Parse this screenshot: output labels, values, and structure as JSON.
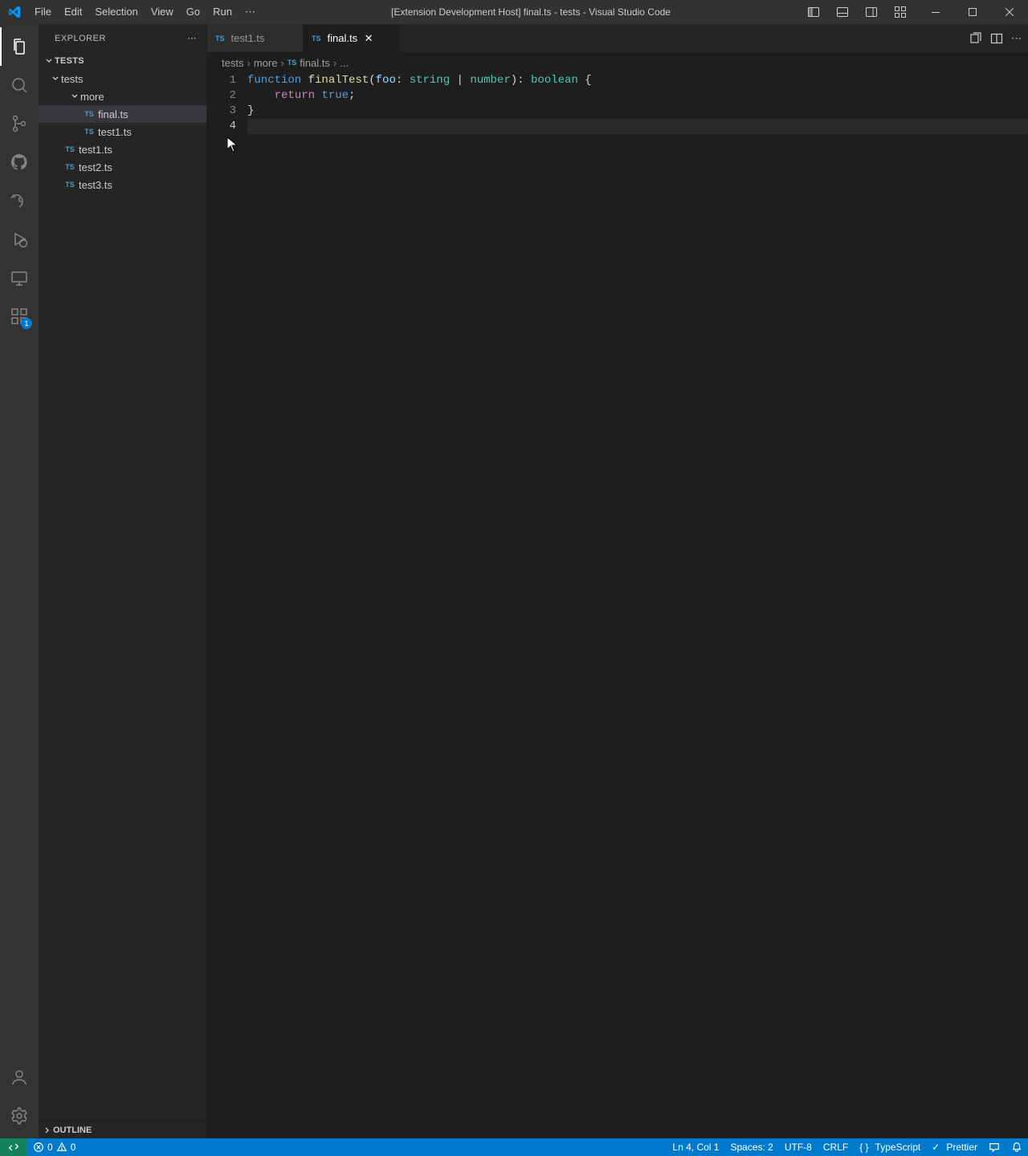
{
  "menu": {
    "items": [
      "File",
      "Edit",
      "Selection",
      "View",
      "Go",
      "Run"
    ],
    "more": "⋯"
  },
  "title": "[Extension Development Host] final.ts - tests - Visual Studio Code",
  "sidebar": {
    "title": "EXPLORER",
    "root": "TESTS",
    "tree": {
      "folder1": "tests",
      "folder2": "more",
      "files_more": [
        "final.ts",
        "test1.ts"
      ],
      "files_root": [
        "test1.ts",
        "test2.ts",
        "test3.ts"
      ]
    },
    "outline": "OUTLINE"
  },
  "tabs": {
    "t1": "test1.ts",
    "t2": "final.ts"
  },
  "breadcrumb": {
    "p1": "tests",
    "p2": "more",
    "p3": "final.ts",
    "p4": "..."
  },
  "code": {
    "lines": [
      "1",
      "2",
      "3",
      "4"
    ],
    "l1": {
      "kw": "function",
      "fn": "finalTest",
      "op1": "(",
      "var": "foo",
      "col": ": ",
      "t1": "string",
      "pipe": " | ",
      "t2": "number",
      "op2": ")",
      "col2": ": ",
      "t3": "boolean",
      "brace": " {"
    },
    "l2": {
      "indent": "    ",
      "kw": "return",
      "sp": " ",
      "val": "true",
      "semi": ";"
    },
    "l3": {
      "brace": "}"
    }
  },
  "status": {
    "errors": "0",
    "warnings": "0",
    "pos": "Ln 4, Col 1",
    "spaces": "Spaces: 2",
    "enc": "UTF-8",
    "eol": "CRLF",
    "lang": "TypeScript",
    "prettier": "Prettier"
  },
  "activity_badge": "1"
}
